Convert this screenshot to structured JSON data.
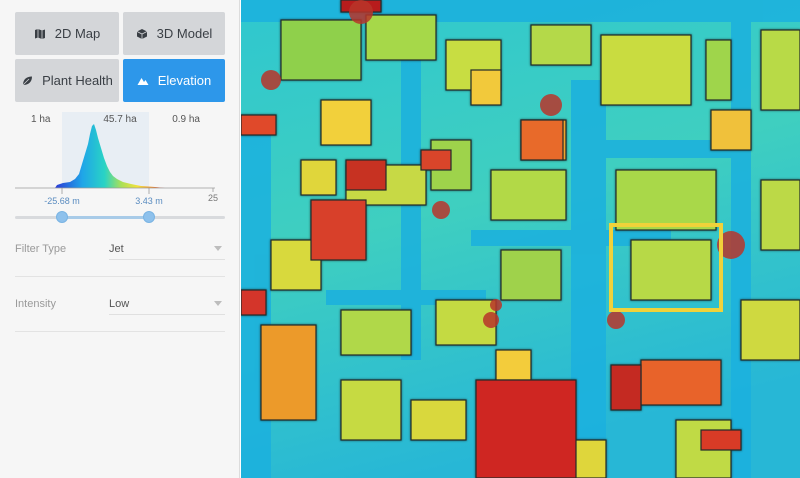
{
  "modes": [
    {
      "label": "2D Map",
      "icon": "map-icon",
      "active": false
    },
    {
      "label": "3D Model",
      "icon": "cube-icon",
      "active": false
    },
    {
      "label": "Plant Health",
      "icon": "leaf-icon",
      "active": false
    },
    {
      "label": "Elevation",
      "icon": "mountain-icon",
      "active": true
    }
  ],
  "histogram": {
    "stat_min": "1 ha",
    "stat_mid": "45.7 ha",
    "stat_max": "0.9 ha",
    "low_label": "-25.68 m",
    "high_label": "3.43 m",
    "axis_end": "25"
  },
  "filter_type": {
    "label": "Filter Type",
    "value": "Jet"
  },
  "intensity": {
    "label": "Intensity",
    "value": "Low"
  },
  "colors": {
    "accent": "#2d97ea",
    "jet": [
      "#1b3bd6",
      "#1fa6e8",
      "#29d3c5",
      "#8ed84e",
      "#e6e23a",
      "#f2a12b",
      "#e0512a",
      "#b51818"
    ]
  }
}
